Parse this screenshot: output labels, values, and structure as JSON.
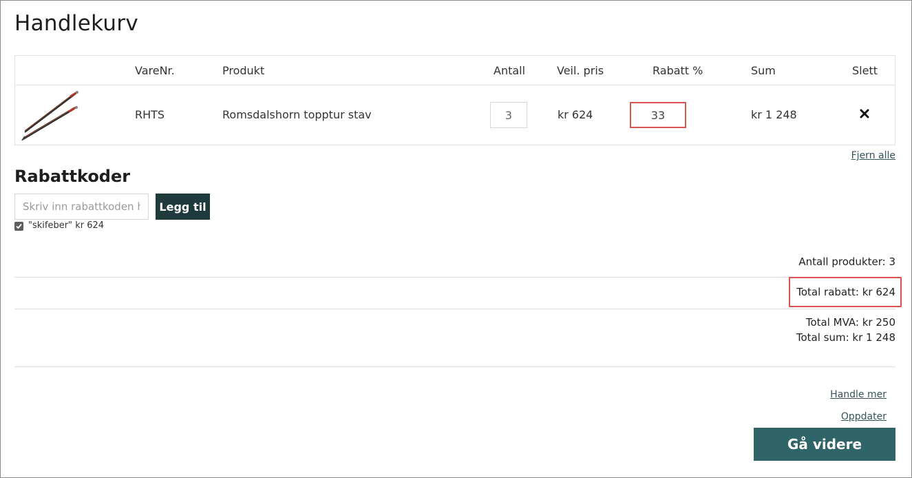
{
  "page": {
    "title": "Handlekurv"
  },
  "cart": {
    "columns": {
      "sku": "VareNr.",
      "product": "Produkt",
      "quantity": "Antall",
      "price": "Veil. pris",
      "discount": "Rabatt %",
      "sum": "Sum",
      "delete": "Slett"
    },
    "items": [
      {
        "image_icon": "ski-poles-image",
        "sku": "RHTS",
        "product": "Romsdalshorn topptur stav",
        "quantity": "3",
        "price": "kr 624",
        "discount": "33",
        "sum": "kr 1 248",
        "delete_icon": "close-icon"
      }
    ],
    "remove_all_label": "Fjern alle"
  },
  "discount_codes": {
    "title": "Rabattkoder",
    "input_placeholder": "Skriv inn rabattkoden her",
    "add_label": "Legg til",
    "applied": [
      {
        "code": "\"skifeber\"",
        "amount": "kr 624",
        "checked": true
      }
    ]
  },
  "summary": {
    "product_count_label": "Antall produkter:",
    "product_count": "3",
    "total_discount_label": "Total rabatt:",
    "total_discount": "kr 624",
    "vat_label": "Total MVA:",
    "vat": "kr 250",
    "total_label": "Total sum:",
    "total": "kr 1 248"
  },
  "actions": {
    "continue_shopping": "Handle mer",
    "update": "Oppdater",
    "checkout": "Gå videre"
  },
  "colors": {
    "highlight": "#d9534f",
    "dark_button": "#1f3a3d",
    "checkout_button": "#2f6468",
    "link": "#35535a"
  }
}
